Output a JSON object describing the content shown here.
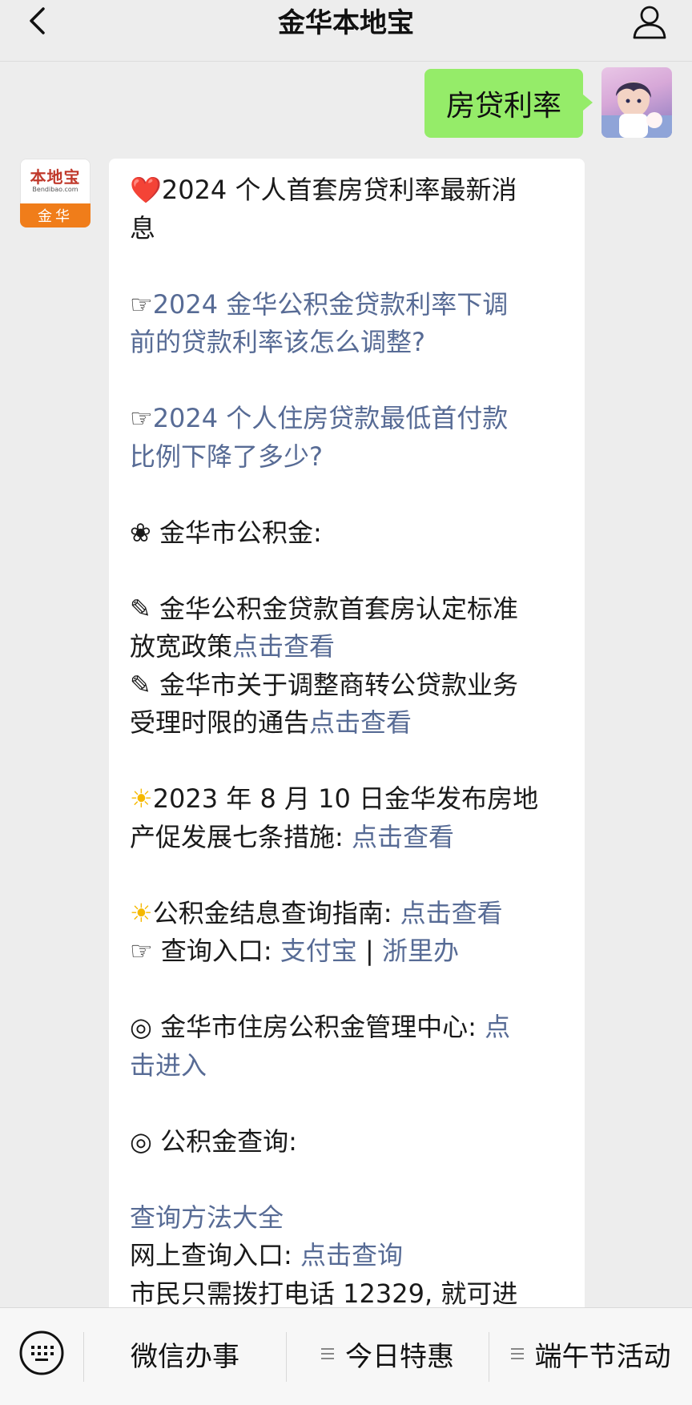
{
  "header": {
    "title": "金华本地宝",
    "back_icon": "chevron-left-icon",
    "profile_icon": "person-icon"
  },
  "user_message": {
    "text": "房贷利率"
  },
  "bot": {
    "avatar": {
      "logo_text": "本地宝",
      "logo_sub": "Bendibao.com",
      "city": "金华"
    },
    "lines": {
      "l1": "2024 个人首套房贷利率最新消",
      "l2": "息",
      "l3_prefix": "☞",
      "l3": "2024 金华公积金贷款利率下调",
      "l4": "前的贷款利率该怎么调整?",
      "l5_prefix": "☞",
      "l5": "2024 个人住房贷款最低首付款",
      "l6": "比例下降了多少?",
      "l7": "❀ 金华市公积金:",
      "l8": "✎ 金华公积金贷款首套房认定标准",
      "l9_text": "放宽政策",
      "l9_link": "点击查看",
      "l10": "✎ 金华市关于调整商转公贷款业务",
      "l11_text": "受理时限的通告",
      "l11_link": "点击查看",
      "l12": "2023 年 8 月 10 日金华发布房地",
      "l13_text": "产促发展七条措施: ",
      "l13_link": "点击查看",
      "l14_text": "公积金结息查询指南: ",
      "l14_link": "点击查看",
      "l15_prefix": "☞ 查询入口: ",
      "l15_link1": "支付宝",
      "l15_sep": " | ",
      "l15_link2": "浙里办",
      "l16_text": "◎ 金华市住房公积金管理中心: ",
      "l16_link": "点",
      "l17_link": "击进入",
      "l18": "◎ 公积金查询:",
      "l19_link": "查询方法大全",
      "l20_text": "网上查询入口: ",
      "l20_link": "点击查询",
      "l21": "市民只需拨打电话 12329, 就可进"
    }
  },
  "bottom_bar": {
    "keyboard_icon": "keyboard-icon",
    "menus": [
      "微信办事",
      "今日特惠",
      "端午节活动"
    ]
  }
}
